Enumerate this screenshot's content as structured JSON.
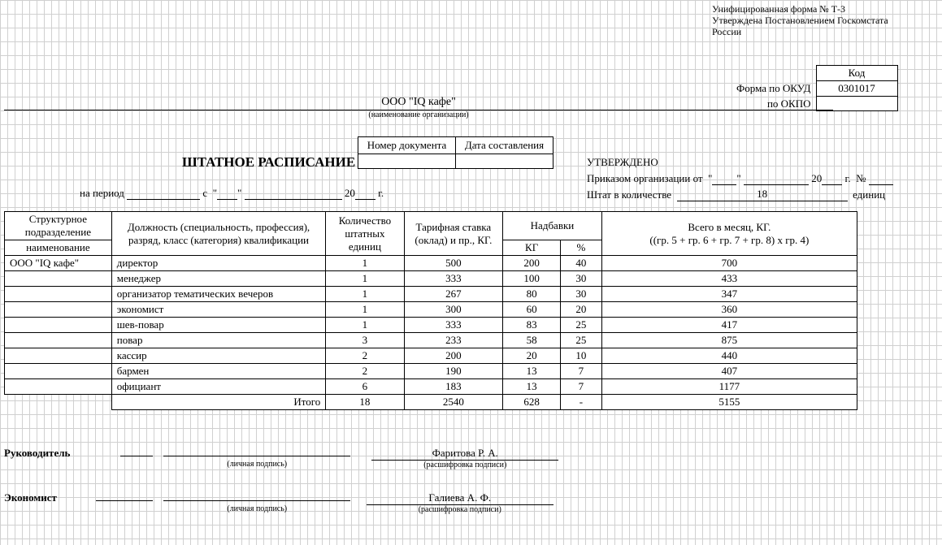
{
  "form_info": {
    "line1": "Унифицированная форма № Т-3",
    "line2": "Утверждена Постановлением Госкомстата",
    "line3": "России"
  },
  "codes": {
    "header": "Код",
    "okud_label": "Форма по ОКУД",
    "okud_value": "0301017",
    "okpo_label": "по ОКПО",
    "okpo_value": ""
  },
  "org_name": "ООО \"IQ кафе\"",
  "org_caption": "(наименование организации)",
  "title": "ШТАТНОЕ РАСПИСАНИЕ",
  "docnum": {
    "num_label": "Номер документа",
    "date_label": "Дата составления",
    "num_value": "",
    "date_value": ""
  },
  "period": {
    "label": "на период",
    "s": "с",
    "year_prefix": "20",
    "year_value": "",
    "g": "г."
  },
  "approval": {
    "title": "УТВЕРЖДЕНО",
    "order_label": "Приказом организации от",
    "year_prefix": "20",
    "g": "г.",
    "num_symbol": "№",
    "staff_count_label": "Штат в количестве",
    "staff_count_value": "18",
    "units": "единиц"
  },
  "table": {
    "headers": {
      "dept": "Структурное подразделение",
      "dept_sub": "наименование",
      "position": "Должность (специальность, профессия), разряд, класс (категория) квалификации",
      "units": "Количество штатных единиц",
      "rate": "Тарифная ставка (оклад) и пр., КГ.",
      "addons": "Надбавки",
      "addon_kg": "КГ",
      "addon_pct": "%",
      "total": "Всего в месяц, КГ.",
      "total_formula": "((гр. 5 + гр. 6 + гр. 7 + гр. 8) x гр. 4)"
    },
    "rows": [
      {
        "dept": "ООО \"IQ кафе\"",
        "pos": "директор",
        "units": "1",
        "rate": "500",
        "kg": "200",
        "pct": "40",
        "total": "700"
      },
      {
        "dept": "",
        "pos": "менеджер",
        "units": "1",
        "rate": "333",
        "kg": "100",
        "pct": "30",
        "total": "433"
      },
      {
        "dept": "",
        "pos": "организатор тематических вечеров",
        "units": "1",
        "rate": "267",
        "kg": "80",
        "pct": "30",
        "total": "347"
      },
      {
        "dept": "",
        "pos": "экономист",
        "units": "1",
        "rate": "300",
        "kg": "60",
        "pct": "20",
        "total": "360"
      },
      {
        "dept": "",
        "pos": "шев-повар",
        "units": "1",
        "rate": "333",
        "kg": "83",
        "pct": "25",
        "total": "417"
      },
      {
        "dept": "",
        "pos": "повар",
        "units": "3",
        "rate": "233",
        "kg": "58",
        "pct": "25",
        "total": "875"
      },
      {
        "dept": "",
        "pos": "кассир",
        "units": "2",
        "rate": "200",
        "kg": "20",
        "pct": "10",
        "total": "440"
      },
      {
        "dept": "",
        "pos": "бармен",
        "units": "2",
        "rate": "190",
        "kg": "13",
        "pct": "7",
        "total": "407"
      },
      {
        "dept": "",
        "pos": "официант",
        "units": "6",
        "rate": "183",
        "kg": "13",
        "pct": "7",
        "total": "1177"
      }
    ],
    "total_row": {
      "label": "Итого",
      "units": "18",
      "rate": "2540",
      "kg": "628",
      "pct": "-",
      "total": "5155"
    }
  },
  "signatures": {
    "leader_label": "Руководитель",
    "leader_name": "Фаритова Р. А.",
    "economist_label": "Экономист",
    "economist_name": "Галиева А. Ф.",
    "personal_sig_caption": "(личная подпись)",
    "decode_caption": "(расшифровка подписи)"
  }
}
